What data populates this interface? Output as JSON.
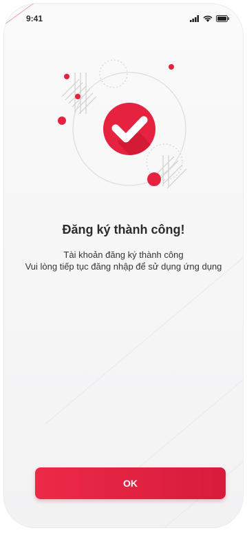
{
  "status_bar": {
    "time": "9:41"
  },
  "content": {
    "title": "Đăng ký thành công!",
    "lines": [
      "Tài khoản đăng ký thành công",
      "Vui lòng tiếp tục đăng nhập để sử dụng ứng dụng"
    ]
  },
  "actions": {
    "ok_label": "OK"
  },
  "colors": {
    "accent": "#E52240",
    "text": "#2B2B2B"
  }
}
